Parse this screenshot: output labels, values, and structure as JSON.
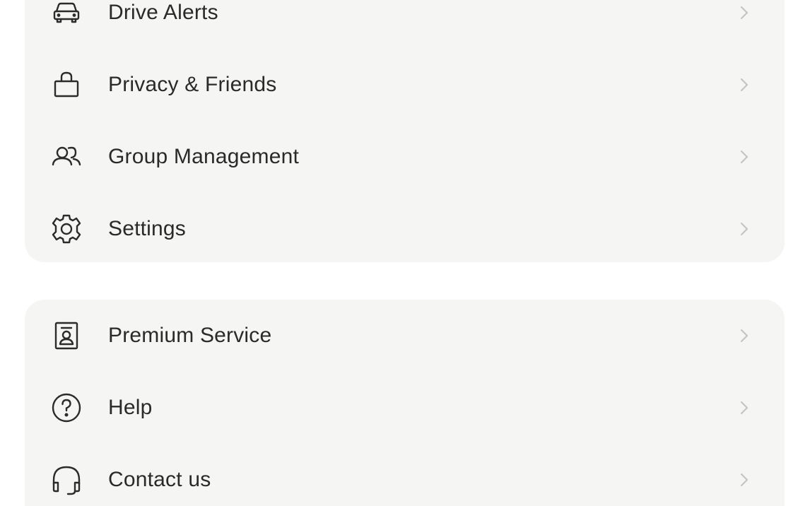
{
  "menu_group_1": {
    "items": [
      {
        "label": "Drive Alerts",
        "icon": "car-icon"
      },
      {
        "label": "Privacy & Friends",
        "icon": "lock-icon"
      },
      {
        "label": "Group Management",
        "icon": "group-icon"
      },
      {
        "label": "Settings",
        "icon": "gear-icon"
      }
    ]
  },
  "menu_group_2": {
    "items": [
      {
        "label": "Premium Service",
        "icon": "id-badge-icon"
      },
      {
        "label": "Help",
        "icon": "help-circle-icon"
      },
      {
        "label": "Contact us",
        "icon": "headset-icon"
      }
    ]
  },
  "colors": {
    "card_background": "#f5f5f3",
    "text": "#2a2a2a",
    "chevron": "#c4c4c4"
  }
}
